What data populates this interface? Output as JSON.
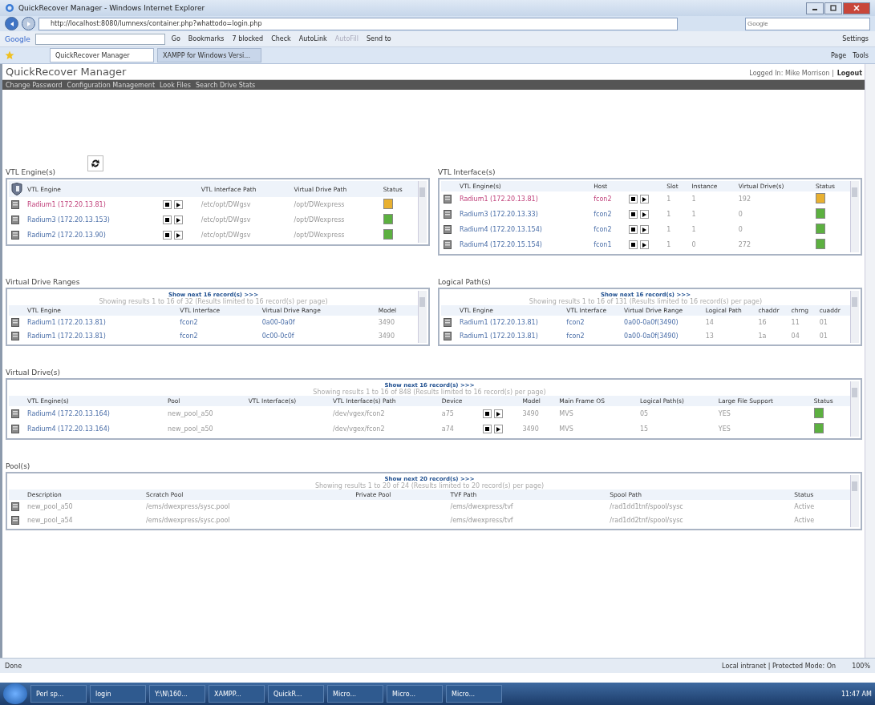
{
  "window": {
    "title": "QuickRecover Manager - Windows Internet Explorer"
  },
  "address_bar": {
    "url": "http://localhost:8080/lumnexs/container.php?whattodo=login.php"
  },
  "search": {
    "placeholder": "Google"
  },
  "google_toolbar": {
    "logo": "Google",
    "items": [
      {
        "label": "Go",
        "disabled": false
      },
      {
        "label": "Bookmarks",
        "disabled": false
      },
      {
        "label": "7 blocked",
        "disabled": false
      },
      {
        "label": "Check",
        "disabled": false
      },
      {
        "label": "AutoLink",
        "disabled": false
      },
      {
        "label": "AutoFill",
        "disabled": true
      },
      {
        "label": "Send to",
        "disabled": false
      }
    ],
    "settings": "Settings"
  },
  "tabs": [
    {
      "label": "QuickRecover Manager",
      "selected": true
    },
    {
      "label": "XAMPP for Windows Versi...",
      "selected": false
    }
  ],
  "command_bar": {
    "items": [
      "Page",
      "Tools"
    ]
  },
  "app": {
    "title": "QuickRecover Manager",
    "user": "Logged In: Mike Morrison |",
    "logout": "Logout",
    "nav": [
      "Change Password",
      "Configuration Management",
      "Look Files",
      "Search Drive Stats"
    ]
  },
  "sections": [
    {
      "panels": [
        {
          "title": "VTL Engine(s)",
          "refresh": true,
          "header_icon": true,
          "columns": [
            {
              "label": "VTL Engine",
              "kind": "link"
            },
            {
              "kind": "controls"
            },
            {
              "label": "VTL Interface Path",
              "kind": "text"
            },
            {
              "label": "Virtual Drive Path",
              "kind": "text"
            },
            {
              "label": "Status",
              "kind": "status"
            }
          ],
          "rows": [
            {
              "selected": true,
              "color": "#e8b030",
              "cells": [
                "Radium1 (172.20.13.81)",
                "",
                "/etc/opt/DWgsv",
                "/opt/DWexpress",
                ""
              ]
            },
            {
              "selected": false,
              "color": "#5cb040",
              "cells": [
                "Radium3 (172.20.13.153)",
                "",
                "/etc/opt/DWgsv",
                "/opt/DWexpress",
                ""
              ]
            },
            {
              "selected": false,
              "color": "#5cb040",
              "cells": [
                "Radium2 (172.20.13.90)",
                "",
                "/etc/opt/DWgsv",
                "/opt/DWexpress",
                ""
              ]
            }
          ]
        },
        {
          "title": "VTL Interface(s)",
          "refresh": false,
          "header_icon": false,
          "columns": [
            {
              "label": "VTL Engine(s)",
              "kind": "link"
            },
            {
              "label": "Host",
              "kind": "link"
            },
            {
              "kind": "controls"
            },
            {
              "label": "Slot",
              "kind": "text"
            },
            {
              "label": "Instance",
              "kind": "text"
            },
            {
              "label": "Virtual Drive(s)",
              "kind": "text"
            },
            {
              "label": "Status",
              "kind": "status"
            }
          ],
          "rows": [
            {
              "selected": true,
              "color": "#e8b030",
              "cells": [
                "Radium1 (172.20.13.81)",
                "fcon2",
                "",
                "1",
                "1",
                "192",
                ""
              ]
            },
            {
              "selected": false,
              "color": "#5cb040",
              "cells": [
                "Radium3 (172.20.13.33)",
                "fcon2",
                "",
                "1",
                "1",
                "0",
                ""
              ]
            },
            {
              "selected": false,
              "color": "#5cb040",
              "cells": [
                "Radium4 (172.20.13.154)",
                "fcon2",
                "",
                "1",
                "1",
                "0",
                ""
              ]
            },
            {
              "selected": false,
              "color": "#5cb040",
              "cells": [
                "Radium4 (172.20.15.154)",
                "fcon1",
                "",
                "1",
                "0",
                "272",
                ""
              ]
            }
          ]
        }
      ]
    },
    {
      "panels": [
        {
          "title": "Virtual Drive Ranges",
          "pager": "Show next 16 record(s) >>>",
          "summary": "Showing results 1 to 16 of 32 (Results limited to 16 record(s) per page)",
          "columns": [
            {
              "label": "VTL Engine",
              "kind": "link"
            },
            {
              "label": "VTL Interface",
              "kind": "link"
            },
            {
              "label": "Virtual Drive Range",
              "kind": "link"
            },
            {
              "label": "Model",
              "kind": "text"
            }
          ],
          "rows": [
            {
              "cells": [
                "Radium1 (172.20.13.81)",
                "fcon2",
                "0a00-0a0f",
                "3490"
              ]
            },
            {
              "cells": [
                "Radium1 (172.20.13.81)",
                "fcon2",
                "0c00-0c0f",
                "3490"
              ]
            }
          ]
        },
        {
          "title": "Logical Path(s)",
          "pager": "Show next 16 record(s) >>>",
          "summary": "Showing results 1 to 16 of 131 (Results limited to 16 record(s) per page)",
          "columns": [
            {
              "label": "VTL Engine",
              "kind": "link"
            },
            {
              "label": "VTL Interface",
              "kind": "link"
            },
            {
              "label": "Virtual Drive Range",
              "kind": "link"
            },
            {
              "label": "Logical Path",
              "kind": "text"
            },
            {
              "label": "chaddr",
              "kind": "text"
            },
            {
              "label": "chrng",
              "kind": "text"
            },
            {
              "label": "cuaddr",
              "kind": "text"
            }
          ],
          "rows": [
            {
              "cells": [
                "Radium1 (172.20.13.81)",
                "fcon2",
                "0a00-0a0f(3490)",
                "14",
                "16",
                "11",
                "01"
              ]
            },
            {
              "cells": [
                "Radium1 (172.20.13.81)",
                "fcon2",
                "0a00-0a0f(3490)",
                "13",
                "1a",
                "04",
                "01"
              ]
            }
          ]
        }
      ]
    },
    {
      "panels": [
        {
          "title": "Virtual Drive(s)",
          "pager": "Show next 16 record(s) >>>",
          "summary": "Showing results 1 to 16 of 848 (Results limited to 16 record(s) per page)",
          "columns": [
            {
              "label": "VTL Engine(s)",
              "kind": "link"
            },
            {
              "label": "Pool",
              "kind": "text"
            },
            {
              "label": "VTL Interface(s)",
              "kind": "blank"
            },
            {
              "label": "VTL Interface(s) Path",
              "kind": "text"
            },
            {
              "label": "Device",
              "kind": "text"
            },
            {
              "kind": "controls"
            },
            {
              "label": "Model",
              "kind": "text"
            },
            {
              "label": "Main Frame OS",
              "kind": "text"
            },
            {
              "label": "Logical Path(s)",
              "kind": "text"
            },
            {
              "label": "Large File Support",
              "kind": "text"
            },
            {
              "label": "Status",
              "kind": "status"
            }
          ],
          "rows": [
            {
              "color": "#5cb040",
              "cells": [
                "Radium4 (172.20.13.164)",
                "new_pool_a50",
                "",
                "/dev/vgex/fcon2",
                "a75",
                "",
                "3490",
                "MVS",
                "05",
                "YES",
                ""
              ]
            },
            {
              "color": "#5cb040",
              "cells": [
                "Radium4 (172.20.13.164)",
                "new_pool_a50",
                "",
                "/dev/vgex/fcon2",
                "a74",
                "",
                "3490",
                "MVS",
                "15",
                "YES",
                ""
              ]
            }
          ]
        }
      ]
    },
    {
      "panels": [
        {
          "title": "Pool(s)",
          "pager": "Show next 20 record(s) >>>",
          "summary": "Showing results 1 to 20 of 24 (Results limited to 20 record(s) per page)",
          "columns": [
            {
              "label": "Description",
              "kind": "text"
            },
            {
              "label": "Scratch Pool",
              "kind": "text"
            },
            {
              "label": "Private Pool",
              "kind": "blank"
            },
            {
              "label": "TVF Path",
              "kind": "text"
            },
            {
              "label": "Spool Path",
              "kind": "text"
            },
            {
              "label": "Status",
              "kind": "text"
            }
          ],
          "rows": [
            {
              "cells": [
                "new_pool_a50",
                "/ems/dwexpress/sysc.pool",
                "",
                "/ems/dwexpress/tvf",
                "/rad1dd1tnf/spool/sysc",
                "Active"
              ]
            },
            {
              "cells": [
                "new_pool_a54",
                "/ems/dwexpress/sysc.pool",
                "",
                "/ems/dwexpress/tvf",
                "/rad1dd2tnf/spool/sysc",
                "Active"
              ]
            }
          ]
        }
      ]
    }
  ],
  "status_bar": {
    "text": "Done",
    "zone": "Local intranet | Protected Mode: On",
    "zoom": "100%"
  },
  "taskbar": {
    "items": [
      "Perl sp...",
      "login",
      "Y:\\N\\160...",
      "XAMPP...",
      "QuickR...",
      "Micro...",
      "Micro...",
      "Micro..."
    ],
    "clock": "11:47 AM"
  }
}
